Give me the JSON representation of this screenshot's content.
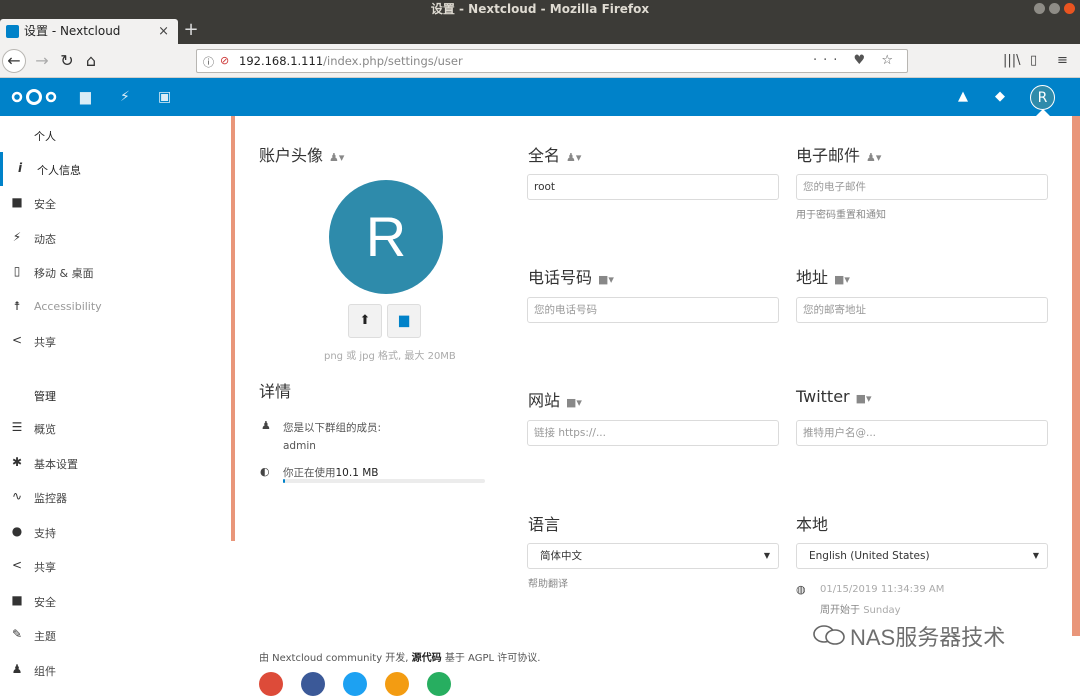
{
  "os": {
    "title": "设置 - Nextcloud - Mozilla Firefox"
  },
  "browser": {
    "tab_title": "设置 - Nextcloud",
    "tab_close": "×",
    "new_tab": "+",
    "url_host": "192.168.1.111",
    "url_path": "/index.php/settings/user",
    "url_actions": "··· ♥ ☆"
  },
  "header": {
    "app_icons": [
      "folder-icon",
      "activity-icon",
      "gallery-icon"
    ],
    "avatar_letter": "R"
  },
  "sidebar": {
    "personal_heading": "个人",
    "personal_items": [
      {
        "label": "个人信息",
        "icon": "info-icon"
      },
      {
        "label": "安全",
        "icon": "lock-icon"
      },
      {
        "label": "动态",
        "icon": "activity-icon"
      },
      {
        "label": "移动 & 桌面",
        "icon": "mobile-icon"
      },
      {
        "label": "Accessibility",
        "icon": "accessibility-icon"
      },
      {
        "label": "共享",
        "icon": "share-icon"
      }
    ],
    "admin_heading": "管理",
    "admin_items": [
      {
        "label": "概览",
        "icon": "overview-icon"
      },
      {
        "label": "基本设置",
        "icon": "gear-icon"
      },
      {
        "label": "监控器",
        "icon": "monitor-icon"
      },
      {
        "label": "支持",
        "icon": "support-icon"
      },
      {
        "label": "共享",
        "icon": "share-icon"
      },
      {
        "label": "安全",
        "icon": "lock-icon"
      },
      {
        "label": "主题",
        "icon": "theme-icon"
      },
      {
        "label": "组件",
        "icon": "apps-icon"
      }
    ]
  },
  "profile": {
    "avatar_title": "账户头像",
    "avatar_letter": "R",
    "avatar_hint": "png 或 jpg 格式, 最大 20MB",
    "details_title": "详情",
    "groups_label": "您是以下群组的成员:",
    "groups_value": "admin",
    "quota_label": "你正在使用",
    "quota_value": "10.1 MB",
    "quota_fraction": 0.01,
    "fullname_title": "全名",
    "fullname_value": "root",
    "email_title": "电子邮件",
    "email_placeholder": "您的电子邮件",
    "email_hint": "用于密码重置和通知",
    "phone_title": "电话号码",
    "phone_placeholder": "您的电话号码",
    "address_title": "地址",
    "address_placeholder": "您的邮寄地址",
    "website_title": "网站",
    "website_placeholder": "链接 https://...",
    "twitter_title": "Twitter",
    "twitter_placeholder": "推特用户名@...",
    "language_title": "语言",
    "language_value": "简体中文",
    "language_help": "帮助翻译",
    "locale_title": "本地",
    "locale_value": "English (United States)",
    "locale_time": "01/15/2019 11:34:39 AM",
    "week_start_label": "周开始于",
    "week_start_value": "Sunday"
  },
  "footer": {
    "prefix": "由 Nextcloud community 开发,",
    "source": "源代码",
    "suffix": "基于 AGPL 许可协议.",
    "social": [
      {
        "name": "google-plus-icon",
        "color": "#dd4b39"
      },
      {
        "name": "facebook-icon",
        "color": "#3b5998"
      },
      {
        "name": "twitter-icon",
        "color": "#1da1f2"
      },
      {
        "name": "rss-icon",
        "color": "#f39c12"
      },
      {
        "name": "mail-icon",
        "color": "#27ae60"
      }
    ]
  },
  "watermark": "NAS服务器技术"
}
